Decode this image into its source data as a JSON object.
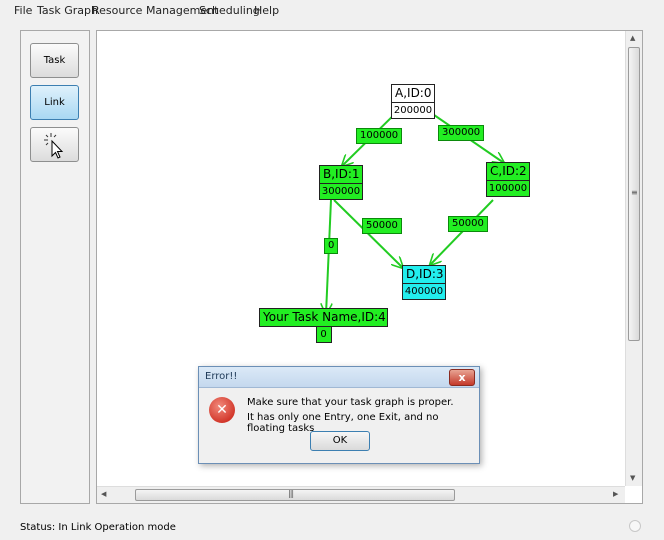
{
  "menu": [
    "File",
    "Task Graph",
    "Resource Management",
    "Scheduling",
    "Help"
  ],
  "tools": {
    "task_label": "Task",
    "link_label": "Link",
    "pointer_icon": "pointer-cursor-icon"
  },
  "colors": {
    "node_green": "#22ee22",
    "node_cyan": "#22eeee",
    "edge": "#22cc22",
    "link_active": "#a9d8f3",
    "error_red": "#c5160a"
  },
  "graph": {
    "nodes": [
      {
        "name": "A,ID:0",
        "value": "200000"
      },
      {
        "name": "B,ID:1",
        "value": "300000"
      },
      {
        "name": "C,ID:2",
        "value": "100000"
      },
      {
        "name": "D,ID:3",
        "value": "400000"
      },
      {
        "name": "Your Task Name,ID:4",
        "value": "0"
      }
    ],
    "edges": [
      {
        "from": "A,ID:0",
        "to": "B,ID:1",
        "label": "100000"
      },
      {
        "from": "A,ID:0",
        "to": "C,ID:2",
        "label": "300000"
      },
      {
        "from": "B,ID:1",
        "to": "D,ID:3",
        "label": "50000"
      },
      {
        "from": "C,ID:2",
        "to": "D,ID:3",
        "label": "50000"
      },
      {
        "from": "B,ID:1",
        "to": "Your Task Name,ID:4",
        "label": "0"
      }
    ]
  },
  "dialog": {
    "title": "Error!!",
    "line1": "Make sure that your task graph is proper.",
    "line2": "It has only one Entry, one Exit, and no floating tasks",
    "ok_label": "OK",
    "close_glyph": "x"
  },
  "status": {
    "text": "Status: In Link Operation mode"
  }
}
